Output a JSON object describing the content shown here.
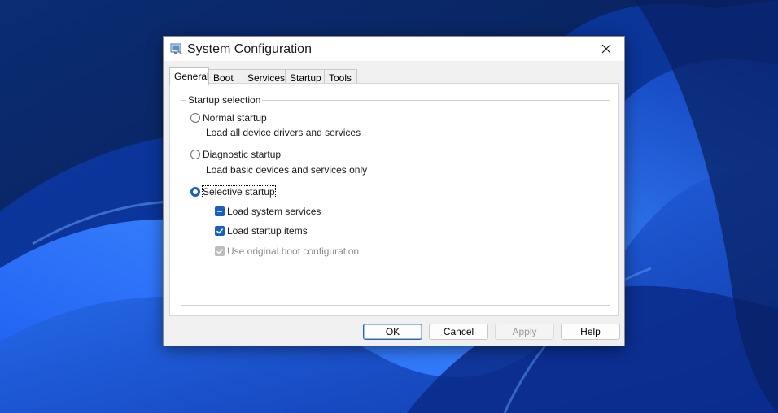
{
  "window": {
    "title": "System Configuration",
    "app_icon": "msconfig-icon",
    "close_icon": "close-icon"
  },
  "tabs": [
    {
      "label": "General",
      "active": true
    },
    {
      "label": "Boot",
      "active": false
    },
    {
      "label": "Services",
      "active": false
    },
    {
      "label": "Startup",
      "active": false
    },
    {
      "label": "Tools",
      "active": false
    }
  ],
  "startup_selection": {
    "legend": "Startup selection",
    "normal": {
      "label": "Normal startup",
      "description": "Load all device drivers and services",
      "selected": false
    },
    "diagnostic": {
      "label": "Diagnostic startup",
      "description": "Load basic devices and services only",
      "selected": false
    },
    "selective": {
      "label": "Selective startup",
      "selected": true
    },
    "options": {
      "load_system_services": {
        "label": "Load system services",
        "state": "indeterminate"
      },
      "load_startup_items": {
        "label": "Load startup items",
        "state": "checked"
      },
      "use_original_boot": {
        "label": "Use original boot configuration",
        "state": "checked-disabled"
      }
    }
  },
  "buttons": {
    "ok": "OK",
    "cancel": "Cancel",
    "apply": "Apply",
    "help": "Help"
  },
  "colors": {
    "accent": "#1a5fc0",
    "disabled": "#bdbdbd"
  }
}
